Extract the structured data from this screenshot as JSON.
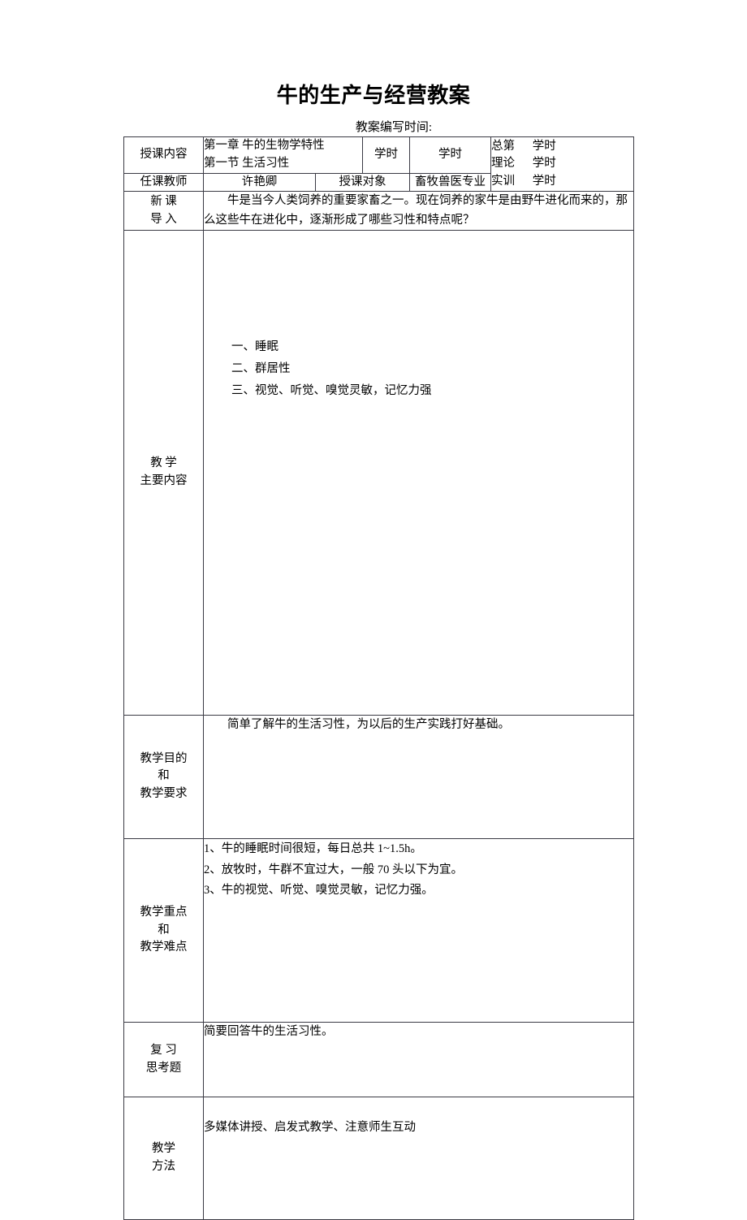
{
  "document": {
    "title": "牛的生产与经营教案",
    "subtitle": "教案编写时间:"
  },
  "table": {
    "row_teaching_content": {
      "label": "授课内容",
      "topic": "第一章  牛的生物学特性\n第一节   生活习性",
      "hours_label_1": "学时",
      "hours_label_2": "学时",
      "hours_summary": {
        "line1": "总第      学时",
        "line2": "理论      学时",
        "line3": "实训      学时"
      }
    },
    "row_teacher": {
      "label": "任课教师",
      "teacher_name": "许艳卿",
      "audience_label": "授课对象",
      "audience_value": "畜牧兽医专业"
    },
    "row_intro": {
      "label": "新  课\n导  入",
      "text": "牛是当今人类饲养的重要家畜之一。现在饲养的家牛是由野牛进化而来的，那么这些牛在进化中，逐渐形成了哪些习性和特点呢？"
    },
    "row_main_content": {
      "label": "教    学\n主要内容",
      "items": [
        "一、睡眠",
        "二、群居性",
        "三、视觉、听觉、嗅觉灵敏，记忆力强"
      ]
    },
    "row_objectives": {
      "label": "教学目的\n和\n教学要求",
      "text": "简单了解牛的生活习性，为以后的生产实践打好基础。"
    },
    "row_key_points": {
      "label": "教学重点\n和\n教学难点",
      "items": [
        "1、牛的睡眠时间很短，每日总共 1~1.5h。",
        "2、放牧时，牛群不宜过大，一般 70 头以下为宜。",
        "3、牛的视觉、听觉、嗅觉灵敏，记忆力强。"
      ]
    },
    "row_review": {
      "label": "复  习\n思考题",
      "text": "简要回答牛的生活习性。"
    },
    "row_methods": {
      "label": "教学\n方法",
      "text": "多媒体讲授、启发式教学、注意师生互动"
    }
  }
}
